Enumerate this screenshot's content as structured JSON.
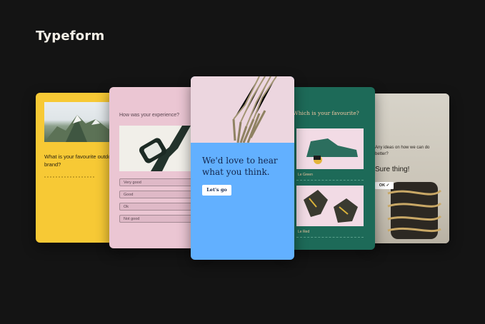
{
  "brand": {
    "name": "Typeform"
  },
  "cards": {
    "yellow": {
      "question": "What is your favourite outdoor brand?"
    },
    "pink": {
      "question": "How was your experience?",
      "options": [
        "Very good",
        "Good",
        "Ok",
        "Not good"
      ]
    },
    "blue": {
      "title": "We'd love to hear what you think.",
      "button": "Let's go"
    },
    "green": {
      "question": "Which is your favourite?",
      "label_1": "Le Green",
      "label_2": "Le Red"
    },
    "grey": {
      "question": "Any ideas on how we can do better?",
      "answer": "Sure thing!",
      "ok_button": "OK ✓"
    }
  },
  "colors": {
    "background": "#141414",
    "yellow": "#f7c935",
    "pink": "#ebc6d3",
    "blue": "#62b0ff",
    "green": "#1d6a58",
    "grey": "#cdc8bd"
  }
}
